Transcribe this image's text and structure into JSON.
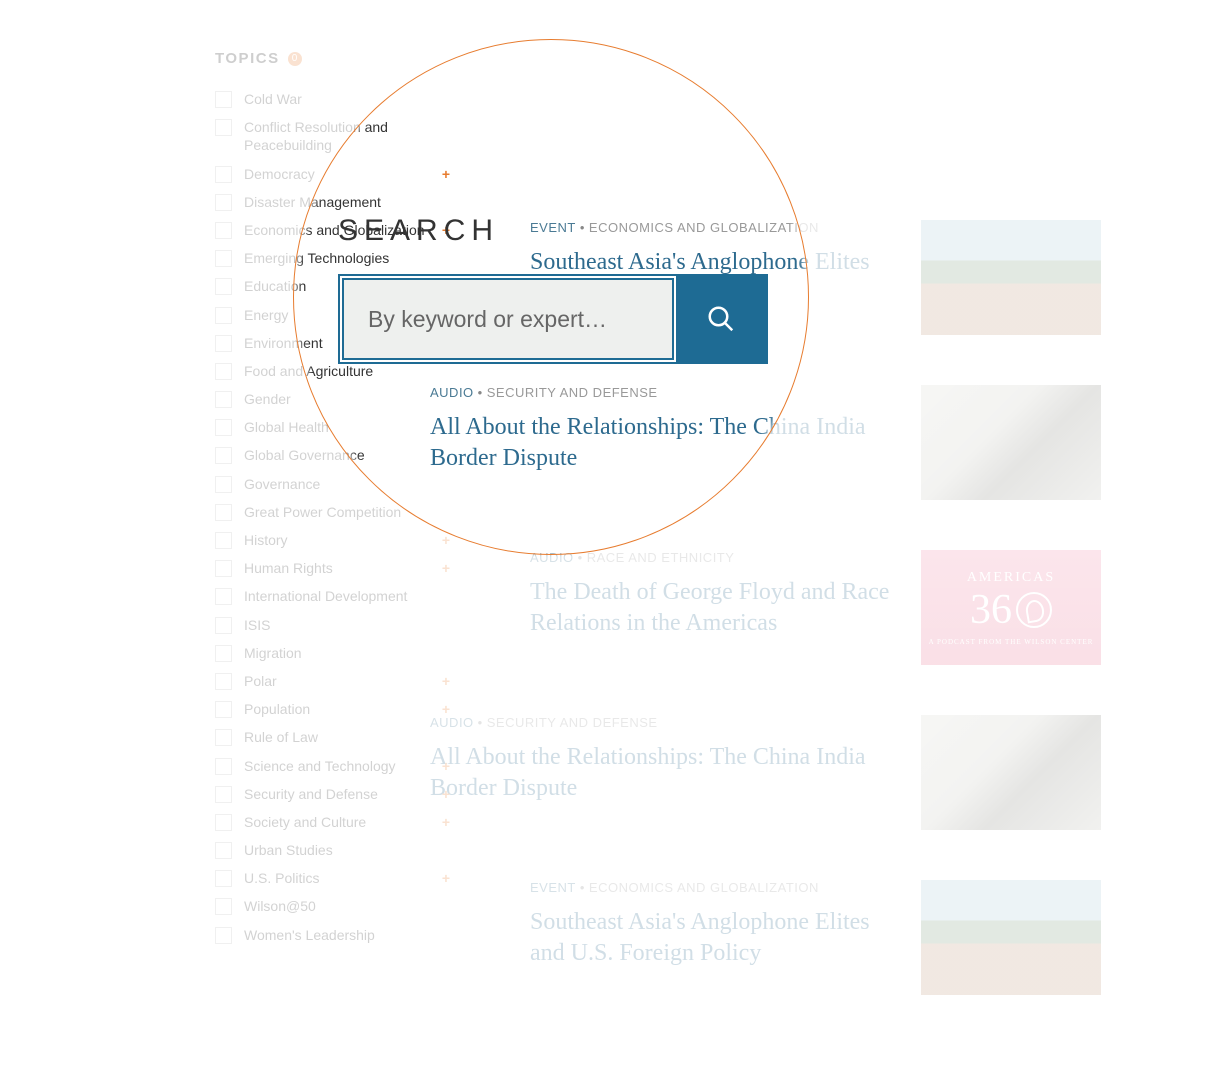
{
  "sidebar": {
    "title": "TOPICS",
    "badge": "0",
    "items": [
      {
        "label": "Cold War",
        "expandable": false
      },
      {
        "label": "Conflict Resolution and Peacebuilding",
        "expandable": false
      },
      {
        "label": "Democracy",
        "expandable": true
      },
      {
        "label": "Disaster Management",
        "expandable": false
      },
      {
        "label": "Economics and Globalization",
        "expandable": true
      },
      {
        "label": "Emerging Technologies",
        "expandable": false
      },
      {
        "label": "Education",
        "expandable": false
      },
      {
        "label": "Energy",
        "expandable": false
      },
      {
        "label": "Environment",
        "expandable": false
      },
      {
        "label": "Food and Agriculture",
        "expandable": false
      },
      {
        "label": "Gender",
        "expandable": false
      },
      {
        "label": "Global Health",
        "expandable": false
      },
      {
        "label": "Global Governance",
        "expandable": false
      },
      {
        "label": "Governance",
        "expandable": false
      },
      {
        "label": "Great Power Competition",
        "expandable": false
      },
      {
        "label": "History",
        "expandable": true
      },
      {
        "label": "Human Rights",
        "expandable": true
      },
      {
        "label": "International Development",
        "expandable": false
      },
      {
        "label": "ISIS",
        "expandable": false
      },
      {
        "label": "Migration",
        "expandable": false
      },
      {
        "label": "Polar",
        "expandable": true
      },
      {
        "label": "Population",
        "expandable": true
      },
      {
        "label": "Rule of Law",
        "expandable": false
      },
      {
        "label": "Science and Technology",
        "expandable": true
      },
      {
        "label": "Security and Defense",
        "expandable": true
      },
      {
        "label": "Society and Culture",
        "expandable": true
      },
      {
        "label": "Urban Studies",
        "expandable": false
      },
      {
        "label": "U.S. Politics",
        "expandable": true
      },
      {
        "label": "Wilson@50",
        "expandable": false
      },
      {
        "label": "Women's Leadership",
        "expandable": false
      }
    ]
  },
  "search": {
    "label": "SEARCH",
    "placeholder": "By keyword or expert…"
  },
  "results": [
    {
      "type": "EVENT",
      "topic": "ECONOMICS AND GLOBALIZATION",
      "title": "Southeast Asia's Anglophone Elites",
      "thumbClass": "thumb-city"
    },
    {
      "type": "AUDIO",
      "topic": "SECURITY AND DEFENSE",
      "title": "All About the Relationships: The China India Border Dispute",
      "thumbClass": "thumb-terrain",
      "compact": true
    },
    {
      "type": "AUDIO",
      "topic": "RACE AND ETHNICITY",
      "title": "The Death of George Floyd and Race Relations in the Americas",
      "thumbClass": "thumb-pink"
    },
    {
      "type": "AUDIO",
      "topic": "SECURITY AND DEFENSE",
      "title": "All About the Relationships: The China India Border Dispute",
      "thumbClass": "thumb-terrain",
      "compact": true
    },
    {
      "type": "EVENT",
      "topic": "ECONOMICS AND GLOBALIZATION",
      "title": "Southeast Asia's Anglophone Elites and U.S. Foreign Policy",
      "thumbClass": "thumb-city"
    }
  ],
  "americas360": {
    "line1": "AMERICAS",
    "line2": "36",
    "line3": "A PODCAST FROM THE WILSON CENTER"
  }
}
